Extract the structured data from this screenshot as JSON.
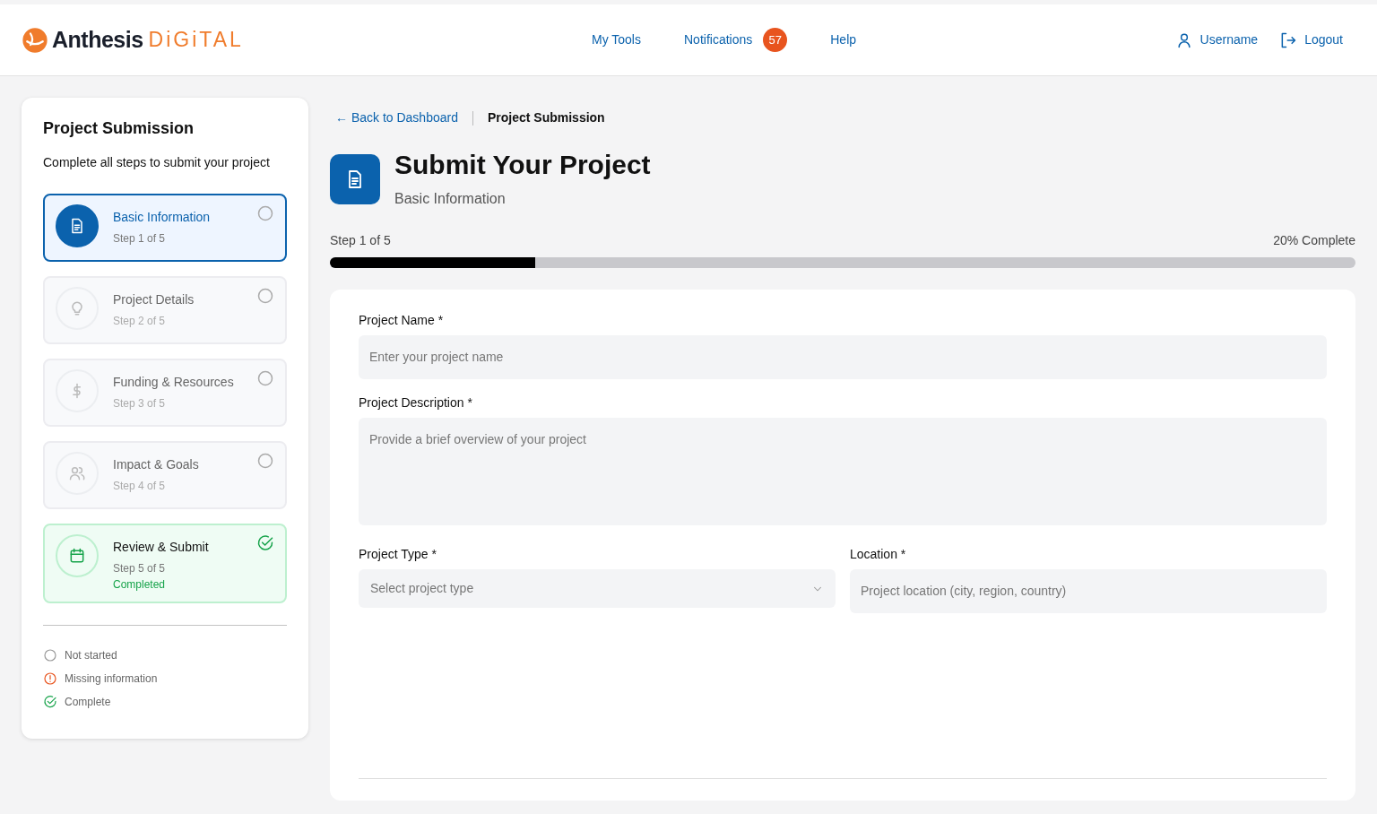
{
  "header": {
    "logo": {
      "brand": "Anthesis",
      "suffix": "DiGiTAL"
    },
    "nav": [
      {
        "label": "My Tools"
      },
      {
        "label": "Notifications",
        "badge": "57"
      },
      {
        "label": "Help"
      }
    ],
    "user": [
      {
        "kind": "user",
        "label": "Username"
      },
      {
        "kind": "logout",
        "label": "Logout"
      }
    ]
  },
  "sidebar": {
    "title": "Project Submission",
    "subtitle": "Complete all steps to submit your project",
    "steps": [
      {
        "kind": "document",
        "title": "Basic Information",
        "step": "Step 1 of 5",
        "complete": false,
        "selected": true
      },
      {
        "kind": "bulb",
        "title": "Project Details",
        "step": "Step 2 of 5",
        "complete": false,
        "selected": false
      },
      {
        "kind": "dollar",
        "title": "Funding & Resources",
        "step": "Step 3 of 5",
        "complete": false,
        "selected": false
      },
      {
        "kind": "people",
        "title": "Impact & Goals",
        "step": "Step 4 of 5",
        "complete": false,
        "selected": false
      },
      {
        "kind": "calendar",
        "title": "Review & Submit",
        "step": "Step 5 of 5",
        "complete": true,
        "note": "Completed",
        "selected": false
      }
    ],
    "legend": [
      {
        "kind": "not_started",
        "label": "Not started"
      },
      {
        "kind": "missing",
        "label": "Missing information"
      },
      {
        "kind": "complete",
        "label": "Complete"
      }
    ]
  },
  "breadcrumb": {
    "back": "← Back to Dashboard",
    "current": "Project Submission"
  },
  "page": {
    "title": "Submit Your Project",
    "subtitle": "Basic Information"
  },
  "progress": {
    "step": "Step 1 of 5",
    "percent": "20% Complete",
    "level": 0.2
  },
  "form": {
    "fields": [
      {
        "kind": "input",
        "label": "Project Name *",
        "placeholder": "Enter your project name"
      },
      {
        "kind": "textarea",
        "label": "Project Description *",
        "placeholder": "Provide a brief overview of your project"
      },
      {
        "kind": "select",
        "label": "Project Type *",
        "placeholder": "Select project type",
        "half": true
      },
      {
        "kind": "input",
        "label": "Location *",
        "placeholder": "Project location (city, region, country)",
        "half": true
      }
    ]
  }
}
